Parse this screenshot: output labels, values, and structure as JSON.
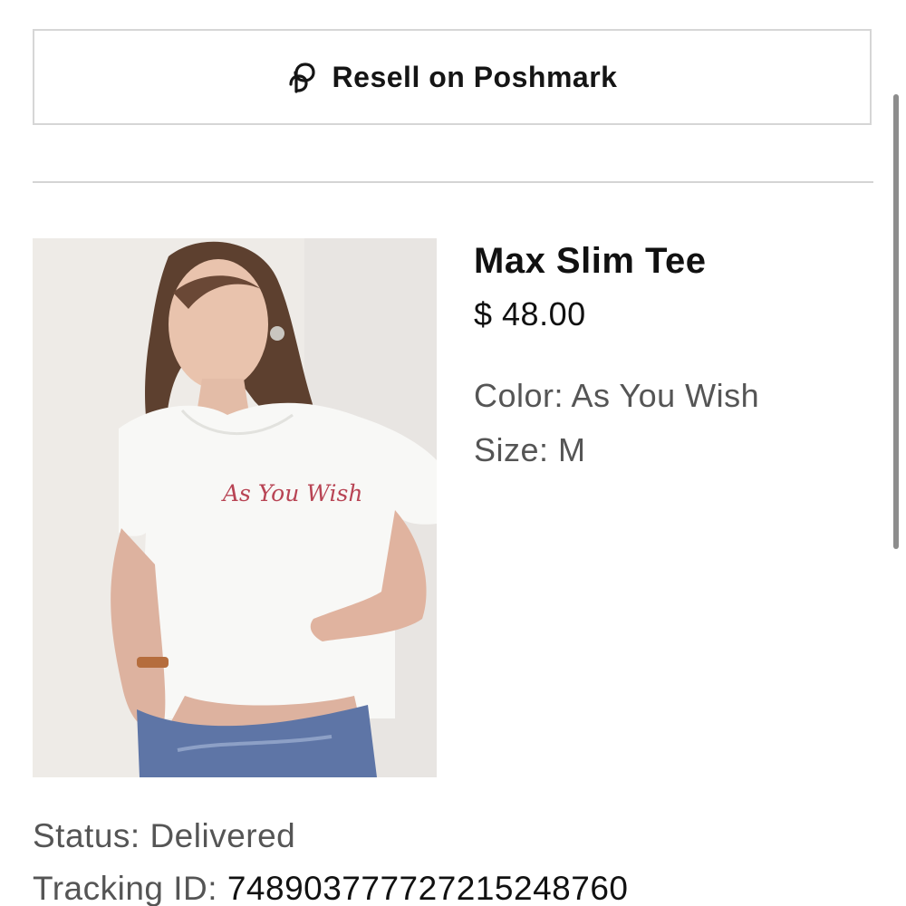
{
  "resell": {
    "label": "Resell on Poshmark",
    "icon": "poshmark-icon"
  },
  "product": {
    "image_icon": "product-photo",
    "image_print_text": "As You Wish",
    "title": "Max Slim Tee",
    "price": "$ 48.00",
    "color_line": "Color: As You Wish",
    "size_line": "Size: M"
  },
  "order": {
    "status_line": "Status: Delivered",
    "tracking_label": "Tracking ID:",
    "tracking_id": "748903777727215248760"
  },
  "colors": {
    "border": "#d6d6d6",
    "text_primary": "#111111",
    "text_secondary": "#555555",
    "print_red": "#b84454"
  }
}
